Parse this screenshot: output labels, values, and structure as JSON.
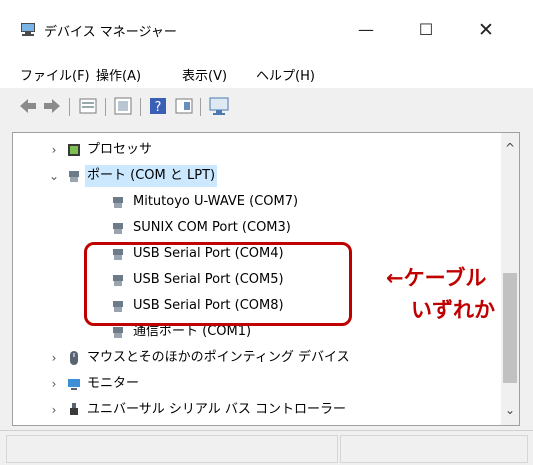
{
  "window": {
    "title": "デバイス マネージャー",
    "minimize_glyph": "—",
    "maximize_glyph": "☐",
    "close_glyph": "✕"
  },
  "menu": {
    "items": [
      "ファイル(F)",
      "操作(A)",
      "表示(V)",
      "ヘルプ(H)"
    ]
  },
  "toolbar": {
    "icons": [
      "back-arrow-icon",
      "forward-arrow-icon",
      "properties-icon",
      "update-driver-icon",
      "help-icon",
      "view-icon",
      "monitor-scan-icon"
    ]
  },
  "tree": {
    "rows": [
      {
        "label": "プロセッサ",
        "icon": "processor-icon",
        "expanded": false
      },
      {
        "label": "ポート (COM と LPT)",
        "icon": "port-icon",
        "expanded": true,
        "selected": true
      },
      {
        "label": "Mitutoyo U-WAVE (COM7)",
        "icon": "port-device-icon"
      },
      {
        "label": "SUNIX COM Port (COM3)",
        "icon": "port-device-icon"
      },
      {
        "label": "USB Serial Port (COM4)",
        "icon": "port-device-icon"
      },
      {
        "label": "USB Serial Port (COM5)",
        "icon": "port-device-icon"
      },
      {
        "label": "USB Serial Port (COM8)",
        "icon": "port-device-icon"
      },
      {
        "label": "通信ポート (COM1)",
        "icon": "port-device-icon"
      },
      {
        "label": "マウスとそのほかのポインティング デバイス",
        "icon": "mouse-icon",
        "expanded": false
      },
      {
        "label": "モニター",
        "icon": "monitor-icon",
        "expanded": false
      },
      {
        "label": "ユニバーサル シリアル バス コントローラー",
        "icon": "usb-icon",
        "expanded": false
      }
    ]
  },
  "annotation": {
    "line1": "←ケーブル",
    "line2": "いずれか",
    "color": "#c00000"
  }
}
